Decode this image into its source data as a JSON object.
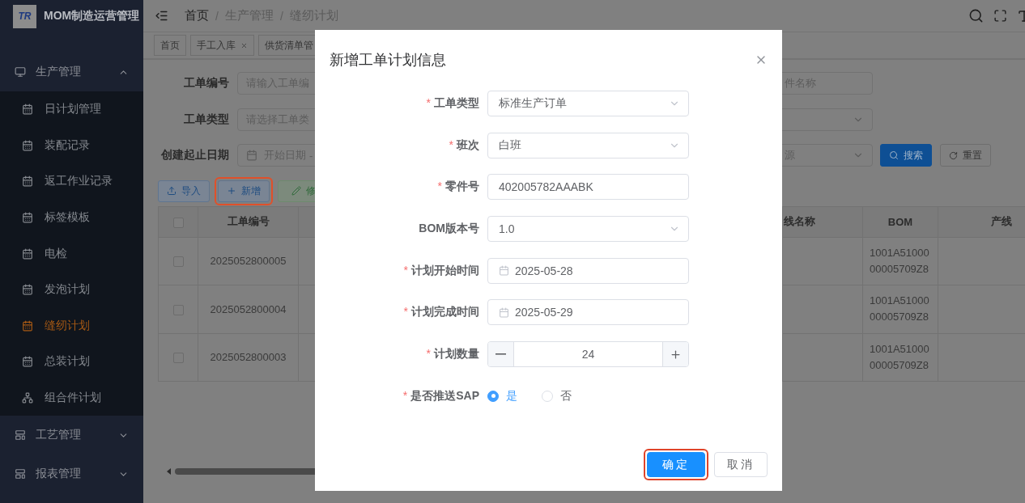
{
  "sidebar": {
    "logo_mark": "TR",
    "title": "MOM制造运营管理",
    "groups": [
      {
        "label": "生产管理",
        "expanded": true,
        "children": [
          {
            "label": "日计划管理",
            "kind": "calendar",
            "selected": false
          },
          {
            "label": "装配记录",
            "kind": "calendar",
            "selected": false
          },
          {
            "label": "返工作业记录",
            "kind": "calendar",
            "selected": false
          },
          {
            "label": "标签模板",
            "kind": "calendar",
            "selected": false
          },
          {
            "label": "电检",
            "kind": "calendar",
            "selected": false
          },
          {
            "label": "发泡计划",
            "kind": "calendar",
            "selected": false
          },
          {
            "label": "缝纫计划",
            "kind": "calendar",
            "selected": true
          },
          {
            "label": "总装计划",
            "kind": "calendar",
            "selected": false
          },
          {
            "label": "组合件计划",
            "kind": "tree",
            "selected": false
          }
        ]
      },
      {
        "label": "工艺管理",
        "expanded": false
      },
      {
        "label": "报表管理",
        "expanded": false
      }
    ]
  },
  "header": {
    "breadcrumb": [
      "首页",
      "生产管理",
      "缝纫计划"
    ],
    "separator": "/"
  },
  "tabs": [
    {
      "label": "首页",
      "closable": false
    },
    {
      "label": "手工入库",
      "closable": true
    },
    {
      "label": "供货清单管",
      "closable": false
    }
  ],
  "filters": {
    "left": [
      {
        "label": "工单编号",
        "kind": "input",
        "placeholder": "请输入工单编"
      },
      {
        "label": "工单类型",
        "kind": "select",
        "placeholder": "请选择工单类"
      },
      {
        "label": "创建起止日期",
        "kind": "daterange",
        "placeholder": "开始日期",
        "separator": "-"
      }
    ],
    "right": [
      {
        "kind": "input",
        "placeholder": "件名称"
      },
      {
        "kind": "select"
      },
      {
        "kind": "select",
        "placeholder": "源"
      }
    ],
    "search_button": "搜索",
    "reset_button": "重置"
  },
  "actions": [
    {
      "label": "导入",
      "kind": "import",
      "highlight": false
    },
    {
      "label": "新增",
      "kind": "add",
      "highlight": true
    },
    {
      "label": "修",
      "kind": "edit",
      "highlight": false
    }
  ],
  "table": {
    "columns": [
      "工单编号",
      "线名称",
      "BOM",
      "产线"
    ],
    "header_checked": false,
    "rows": [
      {
        "checked": false,
        "order_no": "2025052800005",
        "bom": "1001A5100000005709Z8"
      },
      {
        "checked": false,
        "order_no": "2025052800004",
        "bom": "1001A5100000005709Z8"
      },
      {
        "checked": false,
        "order_no": "2025052800003",
        "bom": "1001A5100000005709Z8"
      }
    ]
  },
  "dialog": {
    "title": "新增工单计划信息",
    "required_mark": "*",
    "fields": [
      {
        "label": "工单类型",
        "required": true,
        "kind": "select",
        "value": "标准生产订单"
      },
      {
        "label": "班次",
        "required": true,
        "kind": "select",
        "value": "白班"
      },
      {
        "label": "零件号",
        "required": true,
        "kind": "input",
        "value": "402005782AAABK"
      },
      {
        "label": "BOM版本号",
        "required": false,
        "kind": "select",
        "value": "1.0"
      },
      {
        "label": "计划开始时间",
        "required": true,
        "kind": "date",
        "value": "2025-05-28"
      },
      {
        "label": "计划完成时间",
        "required": true,
        "kind": "date",
        "value": "2025-05-29"
      },
      {
        "label": "计划数量",
        "required": true,
        "kind": "number",
        "value": "24"
      },
      {
        "label": "是否推送SAP",
        "required": true,
        "kind": "radio",
        "options": [
          {
            "label": "是",
            "selected": true
          },
          {
            "label": "否",
            "selected": false
          }
        ]
      }
    ],
    "buttons": [
      {
        "label": "确定",
        "kind": "primary",
        "highlight": true
      },
      {
        "label": "取消",
        "kind": "default",
        "highlight": false
      }
    ]
  }
}
